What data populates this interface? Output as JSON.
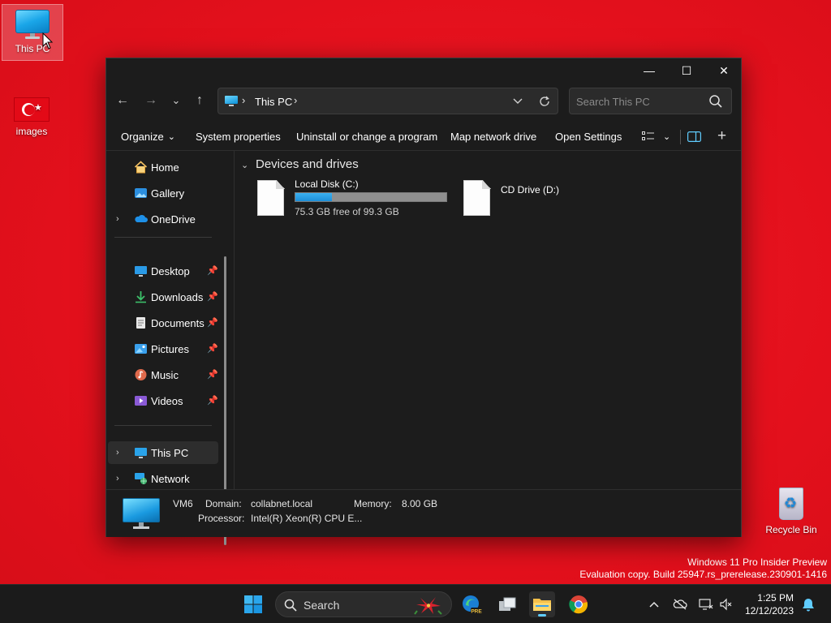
{
  "desktop": {
    "icons": {
      "this_pc": "This PC",
      "images": "images",
      "recycle_bin": "Recycle Bin"
    },
    "watermark": {
      "line1": "Windows 11 Pro Insider Preview",
      "line2": "Evaluation copy. Build 25947.rs_prerelease.230901-1416"
    },
    "background_color": "#e3101c"
  },
  "explorer": {
    "window_buttons": {
      "minimize": "—",
      "maximize": "☐",
      "close": "✕"
    },
    "nav_buttons": {
      "back": "←",
      "forward": "→",
      "recent": "⌄",
      "up": "↑"
    },
    "address": {
      "separator": "›",
      "location": "This PC"
    },
    "search": {
      "placeholder": "Search This PC"
    },
    "toolbar": {
      "organize": "Organize",
      "system_properties": "System properties",
      "uninstall": "Uninstall or change a program",
      "map_network": "Map network drive",
      "open_settings": "Open Settings",
      "chevron": "⌄"
    },
    "nav_pane": {
      "home": "Home",
      "gallery": "Gallery",
      "onedrive": "OneDrive",
      "desktop": "Desktop",
      "downloads": "Downloads",
      "documents": "Documents",
      "pictures": "Pictures",
      "music": "Music",
      "videos": "Videos",
      "this_pc": "This PC",
      "network": "Network",
      "expand_glyph": "›",
      "pin_glyph": "📌"
    },
    "content": {
      "group_title": "Devices and drives",
      "group_chevron": "⌄",
      "drives": [
        {
          "name": "Local Disk (C:)",
          "free": "75.3 GB free of 99.3 GB",
          "used_fraction": 0.242
        },
        {
          "name": "CD Drive (D:)"
        }
      ]
    },
    "details": {
      "computer_name": "VM6",
      "domain_label": "Domain:",
      "domain_value": "collabnet.local",
      "memory_label": "Memory:",
      "memory_value": "8.00 GB",
      "processor_label": "Processor:",
      "processor_value": "Intel(R) Xeon(R) CPU E..."
    }
  },
  "taskbar": {
    "search_label": "Search",
    "clock_time": "1:25 PM",
    "clock_date": "12/12/2023",
    "accent": "#60cdff"
  }
}
